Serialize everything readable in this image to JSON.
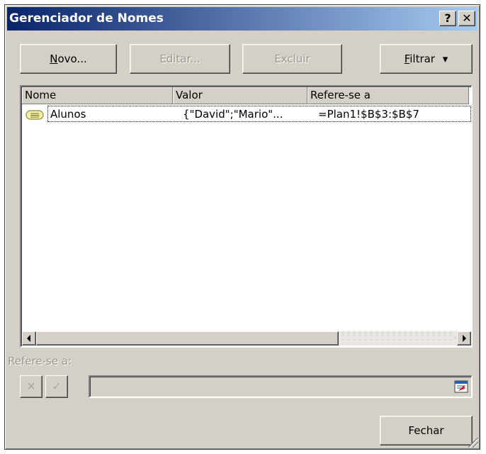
{
  "window": {
    "title": "Gerenciador de Nomes",
    "help_label": "?",
    "close_label": "✕"
  },
  "toolbar": {
    "new_label_key": "N",
    "new_label_rest": "ovo...",
    "edit_label": "Editar...",
    "delete_label": "Excluir",
    "filter_label_key": "F",
    "filter_label_rest": "iltrar",
    "filter_arrow": "▾"
  },
  "list": {
    "columns": [
      "Nome",
      "Valor",
      "Refere-se a"
    ],
    "rows": [
      {
        "name": "Alunos",
        "value": "{\"David\";\"Mario\"...",
        "refers_to": "=Plan1!$B$3:$B$7",
        "icon": "named-range-icon"
      }
    ]
  },
  "refers_to": {
    "label": "Refere-se a:",
    "cancel_glyph": "✕",
    "confirm_glyph": "✓",
    "value": ""
  },
  "footer": {
    "close_label": "Fechar"
  },
  "colors": {
    "titlebar_start": "#0a246a",
    "titlebar_end": "#a6caf0",
    "face": "#d4d0c8",
    "disabled_text": "#9a9890"
  }
}
